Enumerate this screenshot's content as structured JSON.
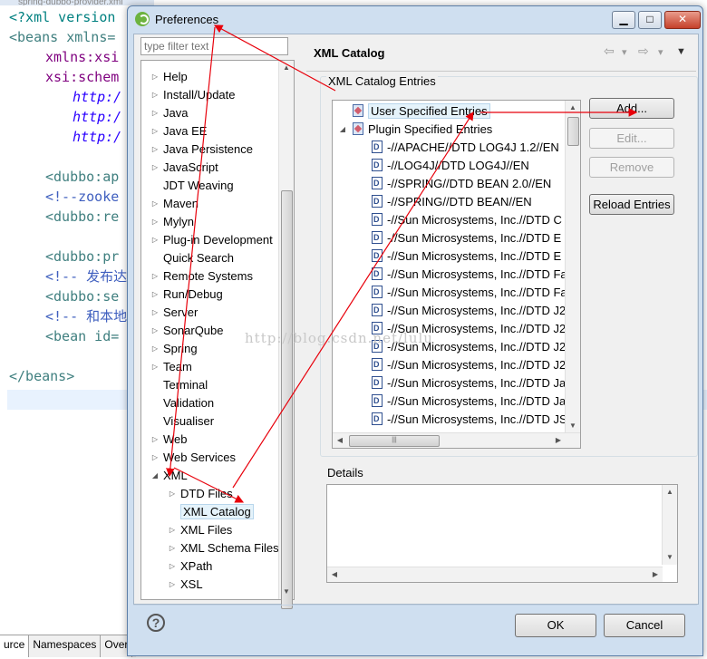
{
  "editor": {
    "tab_title": "spring-dubbo-provider.xml",
    "code_lines": [
      {
        "text": "<?xml version",
        "kind": "proc",
        "indent": 10
      },
      {
        "text": "<beans xmlns=",
        "kind": "tag",
        "indent": 10
      },
      {
        "text": "xmlns:xsi",
        "kind": "attr",
        "indent": 50
      },
      {
        "text": "xsi:schem",
        "kind": "attr",
        "indent": 50
      },
      {
        "text": "http:/",
        "kind": "str",
        "indent": 80
      },
      {
        "text": "http:/",
        "kind": "str",
        "indent": 80
      },
      {
        "text": "http:/",
        "kind": "str",
        "indent": 80
      },
      {
        "text": "",
        "kind": "tag",
        "indent": 10
      },
      {
        "text": "<dubbo:ap",
        "kind": "tag",
        "indent": 50
      },
      {
        "text": "<!--zooke",
        "kind": "cmt",
        "indent": 50
      },
      {
        "text": "<dubbo:re",
        "kind": "tag",
        "indent": 50
      },
      {
        "text": "",
        "kind": "tag",
        "indent": 10
      },
      {
        "text": "<dubbo:pr",
        "kind": "tag",
        "indent": 50
      },
      {
        "text": "<!-- 发布达",
        "kind": "cmt",
        "indent": 50
      },
      {
        "text": "<dubbo:se",
        "kind": "tag",
        "indent": 50
      },
      {
        "text": "<!-- 和本地",
        "kind": "cmt",
        "indent": 50
      },
      {
        "text": "<bean id=",
        "kind": "tag",
        "indent": 50
      },
      {
        "text": "",
        "kind": "tag",
        "indent": 10
      },
      {
        "text": "</beans>",
        "kind": "tag",
        "indent": 10
      }
    ],
    "bottom_tabs": [
      "urce",
      "Namespaces",
      "Over"
    ]
  },
  "dialog": {
    "title": "Preferences",
    "min_label": "▁",
    "max_label": "□",
    "close_label": "✕",
    "filter_placeholder": "type filter text",
    "tree": [
      {
        "label": "Help",
        "twisty": "closed",
        "level": 0
      },
      {
        "label": "Install/Update",
        "twisty": "closed",
        "level": 0
      },
      {
        "label": "Java",
        "twisty": "closed",
        "level": 0
      },
      {
        "label": "Java EE",
        "twisty": "closed",
        "level": 0
      },
      {
        "label": "Java Persistence",
        "twisty": "closed",
        "level": 0
      },
      {
        "label": "JavaScript",
        "twisty": "closed",
        "level": 0
      },
      {
        "label": "JDT Weaving",
        "twisty": "none",
        "level": 0
      },
      {
        "label": "Maven",
        "twisty": "closed",
        "level": 0
      },
      {
        "label": "Mylyn",
        "twisty": "closed",
        "level": 0
      },
      {
        "label": "Plug-in Development",
        "twisty": "closed",
        "level": 0
      },
      {
        "label": "Quick Search",
        "twisty": "none",
        "level": 0
      },
      {
        "label": "Remote Systems",
        "twisty": "closed",
        "level": 0
      },
      {
        "label": "Run/Debug",
        "twisty": "closed",
        "level": 0
      },
      {
        "label": "Server",
        "twisty": "closed",
        "level": 0
      },
      {
        "label": "SonarQube",
        "twisty": "closed",
        "level": 0
      },
      {
        "label": "Spring",
        "twisty": "closed",
        "level": 0
      },
      {
        "label": "Team",
        "twisty": "closed",
        "level": 0
      },
      {
        "label": "Terminal",
        "twisty": "none",
        "level": 0
      },
      {
        "label": "Validation",
        "twisty": "none",
        "level": 0
      },
      {
        "label": "Visualiser",
        "twisty": "none",
        "level": 0
      },
      {
        "label": "Web",
        "twisty": "closed",
        "level": 0
      },
      {
        "label": "Web Services",
        "twisty": "closed",
        "level": 0
      },
      {
        "label": "XML",
        "twisty": "open",
        "level": 0
      },
      {
        "label": "DTD Files",
        "twisty": "closed",
        "level": 1
      },
      {
        "label": "XML Catalog",
        "twisty": "none",
        "level": 1,
        "selected": true
      },
      {
        "label": "XML Files",
        "twisty": "closed",
        "level": 1
      },
      {
        "label": "XML Schema Files",
        "twisty": "closed",
        "level": 1
      },
      {
        "label": "XPath",
        "twisty": "closed",
        "level": 1
      },
      {
        "label": "XSL",
        "twisty": "closed",
        "level": 1
      }
    ],
    "page_title": "XML Catalog",
    "nav": {
      "back": "⇦",
      "back_menu": "▾",
      "forward": "⇨",
      "forward_menu": "▾",
      "view_menu": "▼"
    },
    "entries_group_label": "XML Catalog Entries",
    "entries": [
      {
        "label": "User Specified Entries",
        "icon": "folder",
        "level": 0,
        "twisty": "none",
        "selected": true
      },
      {
        "label": "Plugin Specified Entries",
        "icon": "folder",
        "level": 0,
        "twisty": "open"
      },
      {
        "label": "-//APACHE//DTD LOG4J 1.2//EN",
        "icon": "doc",
        "level": 1
      },
      {
        "label": "-//LOG4J//DTD LOG4J//EN",
        "icon": "doc",
        "level": 1
      },
      {
        "label": "-//SPRING//DTD BEAN 2.0//EN",
        "icon": "doc",
        "level": 1
      },
      {
        "label": "-//SPRING//DTD BEAN//EN",
        "icon": "doc",
        "level": 1
      },
      {
        "label": "-//Sun Microsystems, Inc.//DTD C",
        "icon": "doc",
        "level": 1
      },
      {
        "label": "-//Sun Microsystems, Inc.//DTD E",
        "icon": "doc",
        "level": 1
      },
      {
        "label": "-//Sun Microsystems, Inc.//DTD E",
        "icon": "doc",
        "level": 1
      },
      {
        "label": "-//Sun Microsystems, Inc.//DTD Fa",
        "icon": "doc",
        "level": 1
      },
      {
        "label": "-//Sun Microsystems, Inc.//DTD Fa",
        "icon": "doc",
        "level": 1
      },
      {
        "label": "-//Sun Microsystems, Inc.//DTD J2",
        "icon": "doc",
        "level": 1
      },
      {
        "label": "-//Sun Microsystems, Inc.//DTD J2",
        "icon": "doc",
        "level": 1
      },
      {
        "label": "-//Sun Microsystems, Inc.//DTD J2",
        "icon": "doc",
        "level": 1
      },
      {
        "label": "-//Sun Microsystems, Inc.//DTD J2",
        "icon": "doc",
        "level": 1
      },
      {
        "label": "-//Sun Microsystems, Inc.//DTD Ja",
        "icon": "doc",
        "level": 1
      },
      {
        "label": "-//Sun Microsystems, Inc.//DTD Ja",
        "icon": "doc",
        "level": 1
      },
      {
        "label": "-//Sun Microsystems, Inc.//DTD JS",
        "icon": "doc",
        "level": 1
      }
    ],
    "buttons": {
      "add": "Add...",
      "edit": "Edit...",
      "remove": "Remove",
      "reload": "Reload Entries"
    },
    "details_label": "Details",
    "help_label": "?",
    "ok": "OK",
    "cancel": "Cancel"
  },
  "watermark": "http://blog.csdn.net/lulu",
  "annotation_color": "#e8000b"
}
